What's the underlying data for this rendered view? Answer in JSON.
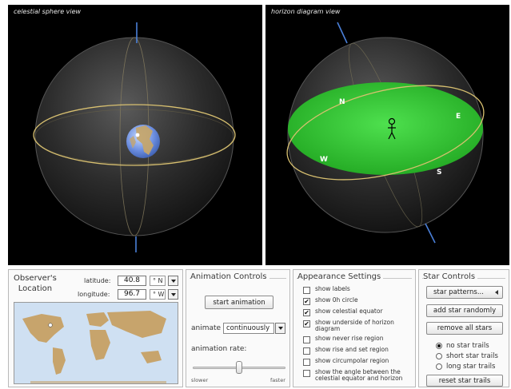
{
  "views": {
    "celestial_title": "celestial sphere view",
    "horizon_title": "horizon diagram view",
    "compass": {
      "north": "N",
      "east": "E",
      "south": "S",
      "west": "W"
    }
  },
  "observer": {
    "title_line1": "Observer's",
    "title_line2": "Location",
    "latitude_label": "latitude:",
    "latitude_value": "40.8",
    "latitude_unit": "° N",
    "longitude_label": "longitude:",
    "longitude_value": "96.7",
    "longitude_unit": "° W"
  },
  "animation": {
    "title": "Animation Controls",
    "start_label": "start animation",
    "animate_label": "animate",
    "animate_mode": "continuously",
    "rate_label": "animation rate:",
    "slower_label": "slower",
    "faster_label": "faster",
    "rate_fraction": 0.5
  },
  "appearance": {
    "title": "Appearance Settings",
    "options": [
      {
        "label": "show labels",
        "checked": false
      },
      {
        "label": "show 0h circle",
        "checked": true
      },
      {
        "label": "show celestial equator",
        "checked": true
      },
      {
        "label": "show underside of horizon diagram",
        "checked": true
      },
      {
        "label": "show never rise region",
        "checked": false
      },
      {
        "label": "show rise and set region",
        "checked": false
      },
      {
        "label": "show circumpolar region",
        "checked": false
      },
      {
        "label": "show the angle between the celestial equator and horizon",
        "checked": false
      }
    ]
  },
  "stars": {
    "title": "Star Controls",
    "patterns_label": "star patterns...",
    "add_label": "add star randomly",
    "remove_label": "remove all stars",
    "trails": [
      {
        "label": "no star trails",
        "selected": true
      },
      {
        "label": "short star trails",
        "selected": false
      },
      {
        "label": "long star trails",
        "selected": false
      }
    ],
    "reset_label": "reset star trails"
  },
  "colors": {
    "horizon_plane": "#33c433",
    "equator_ring": "#d8c070",
    "pole_axis": "#4a7fd8",
    "ocean": "#cfe0f2",
    "land": "#c7a46c"
  }
}
